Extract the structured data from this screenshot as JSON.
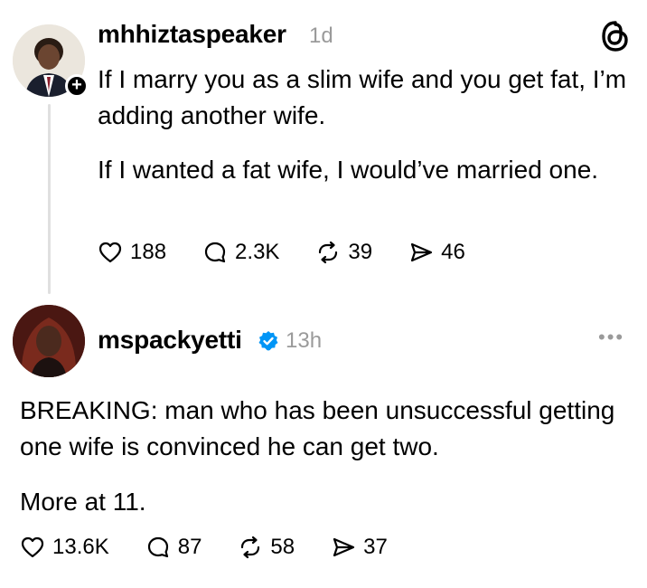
{
  "post1": {
    "username": "mhhiztaspeaker",
    "time": "1d",
    "paragraph1": "If I marry you as a slim wife and you get fat, I’m adding another wife.",
    "paragraph2": "If I wanted a fat wife, I would’ve married one.",
    "likes": "188",
    "replies": "2.3K",
    "reposts": "39",
    "shares": "46",
    "follow_badge": "+"
  },
  "post2": {
    "username": "mspackyetti",
    "time": "13h",
    "paragraph1": "BREAKING: man who has been unsuccessful getting one wife is convinced he can get two.",
    "paragraph2": "More at 11.",
    "likes": "13.6K",
    "replies": "87",
    "reposts": "58",
    "shares": "37",
    "more_label": "•••"
  },
  "icons": [
    "heart-icon",
    "reply-icon",
    "repost-icon",
    "share-icon",
    "threads-logo-icon",
    "verified-icon",
    "more-icon"
  ],
  "colors": {
    "verified": "#0095f6",
    "muted": "#9a9a9a",
    "thread_line": "#e0e0e0"
  }
}
